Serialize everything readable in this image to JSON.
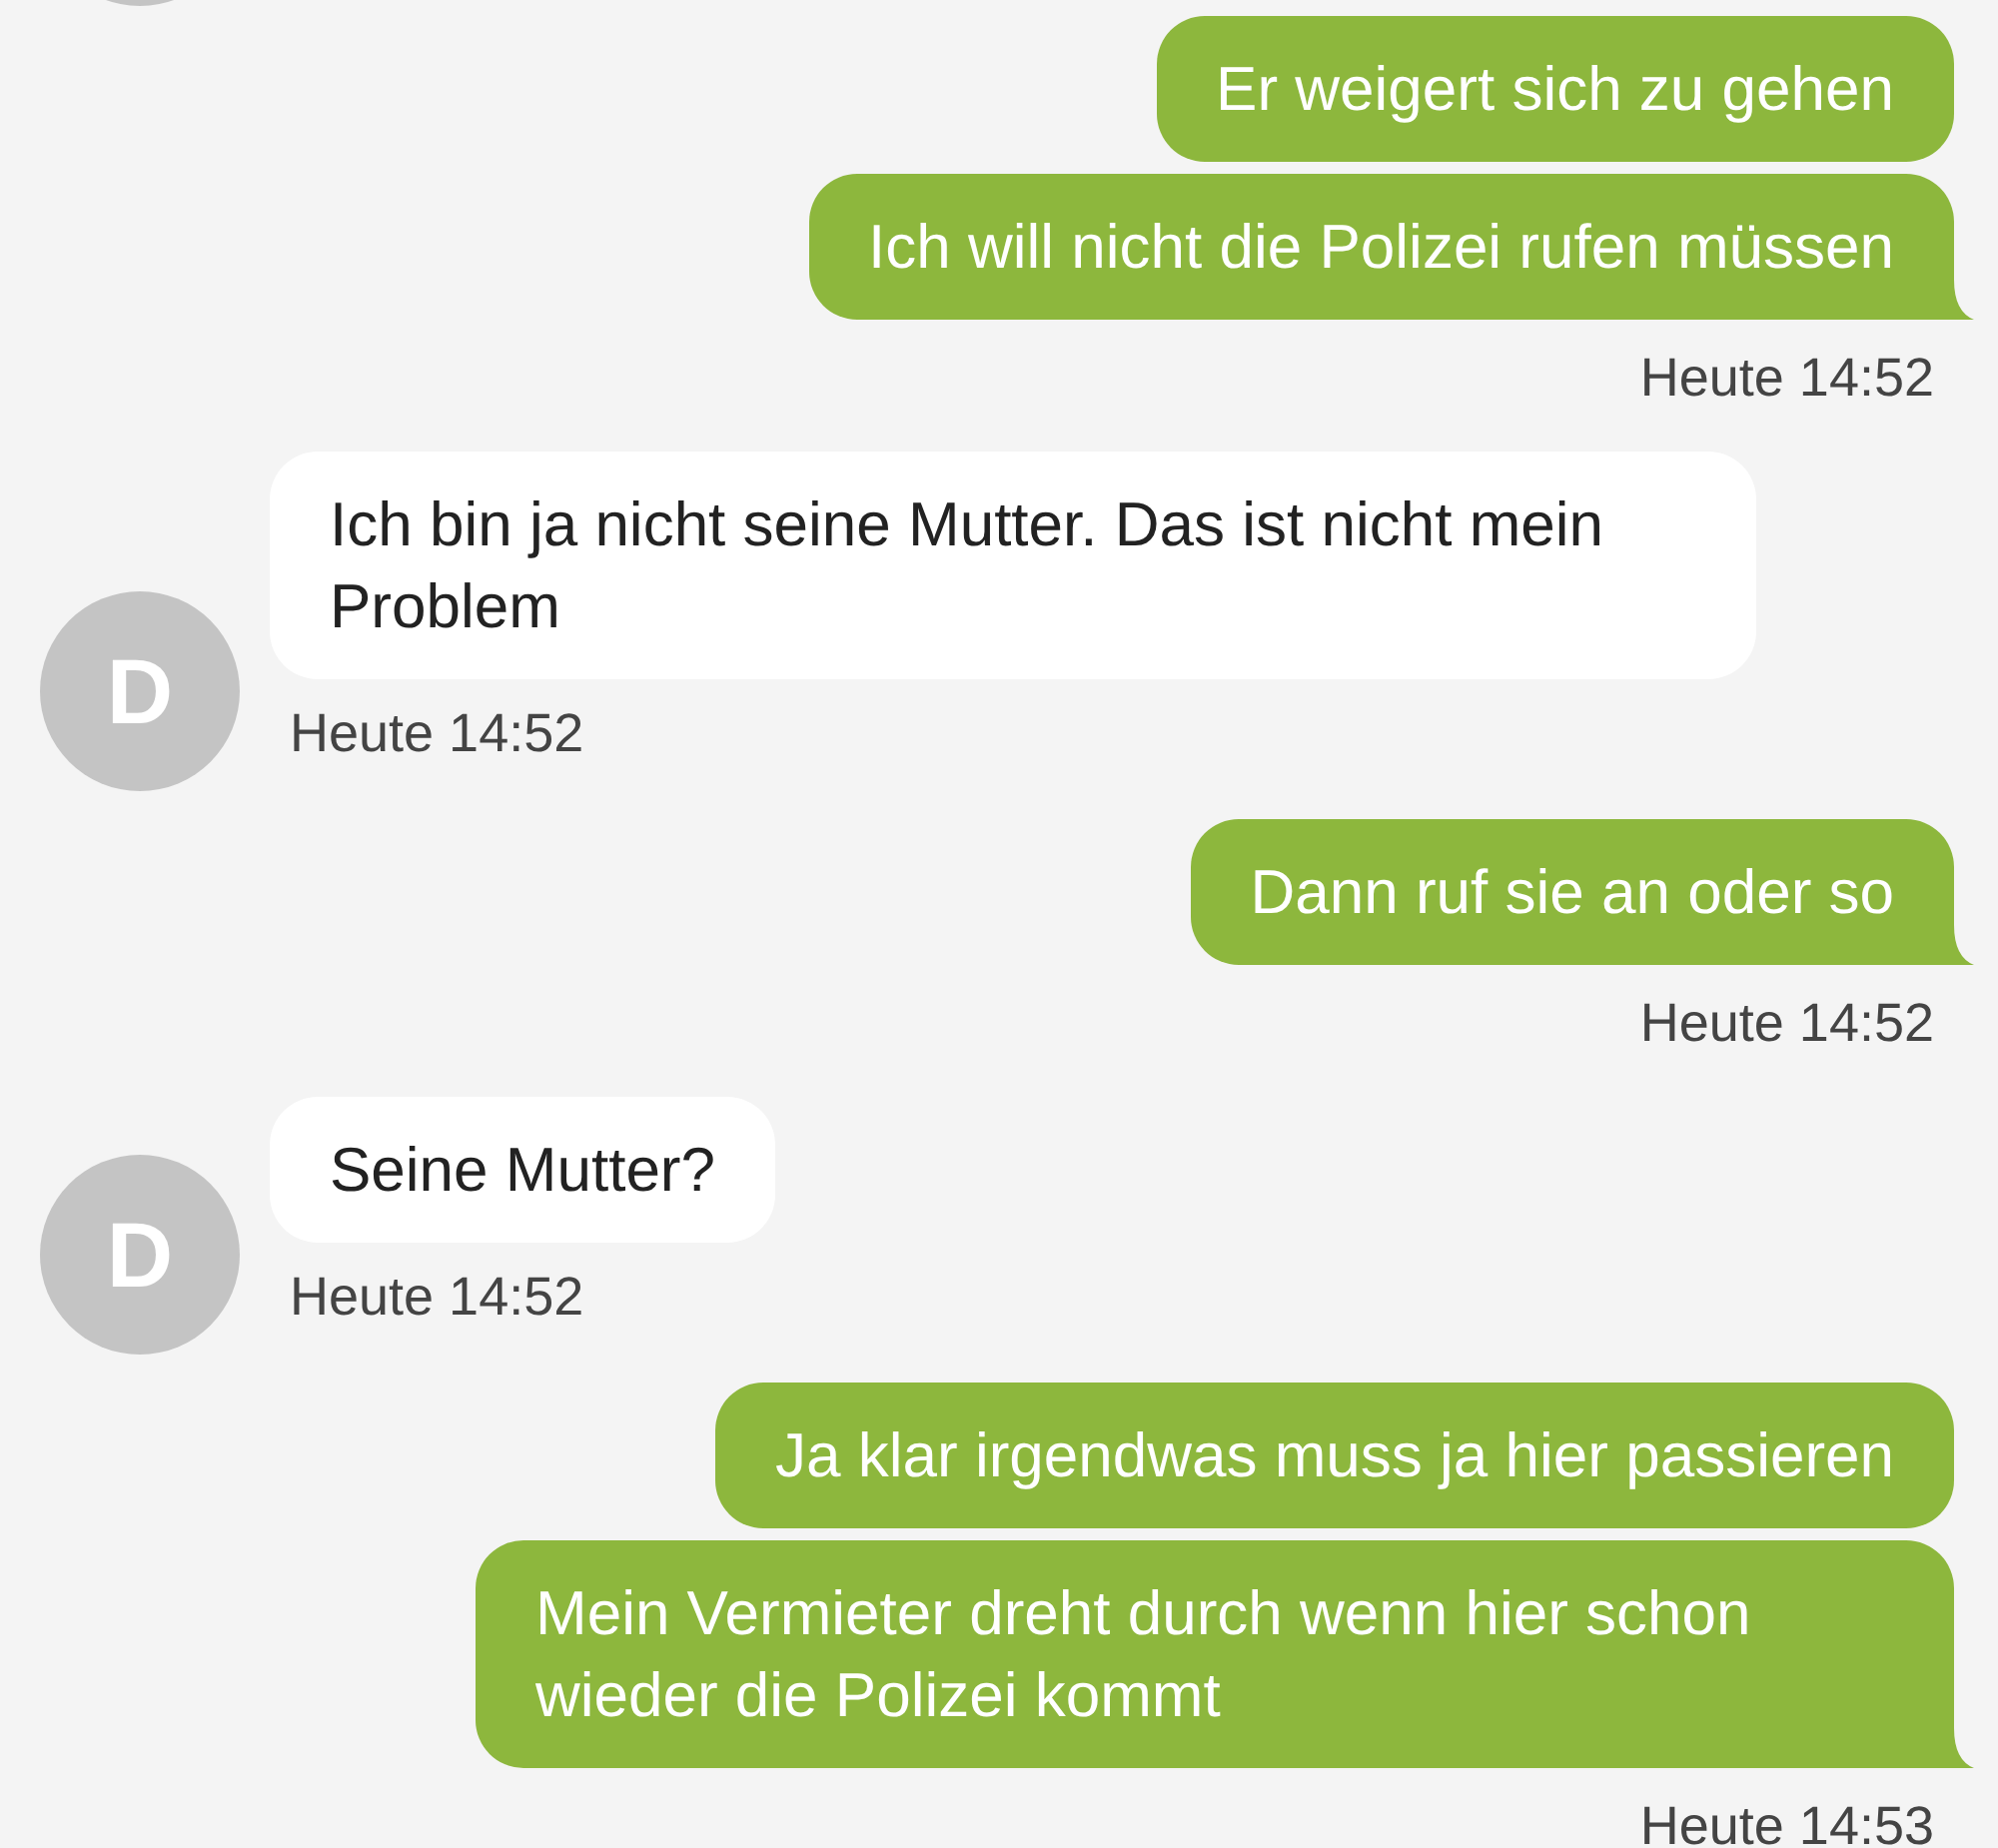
{
  "messages": [
    {
      "kind": "sent",
      "text": "Er weigert sich zu gehen"
    },
    {
      "kind": "sent",
      "text": "Ich will nicht die Polizei rufen müssen"
    },
    {
      "kind": "time",
      "time": "Heute 14:52"
    },
    {
      "kind": "received",
      "avatar": "D",
      "text": "Ich bin ja nicht seine Mutter. Das ist nicht mein Problem",
      "time": "Heute 14:52"
    },
    {
      "kind": "sent",
      "text": "Dann ruf sie an oder so"
    },
    {
      "kind": "time",
      "time": "Heute 14:52"
    },
    {
      "kind": "received",
      "avatar": "D",
      "text": "Seine Mutter?",
      "time": "Heute 14:52"
    },
    {
      "kind": "sent",
      "text": "Ja klar irgendwas muss ja hier passieren"
    },
    {
      "kind": "sent",
      "text": "Mein Vermieter dreht durch wenn hier schon wieder die Polizei kommt"
    },
    {
      "kind": "time",
      "time": "Heute 14:53"
    }
  ]
}
